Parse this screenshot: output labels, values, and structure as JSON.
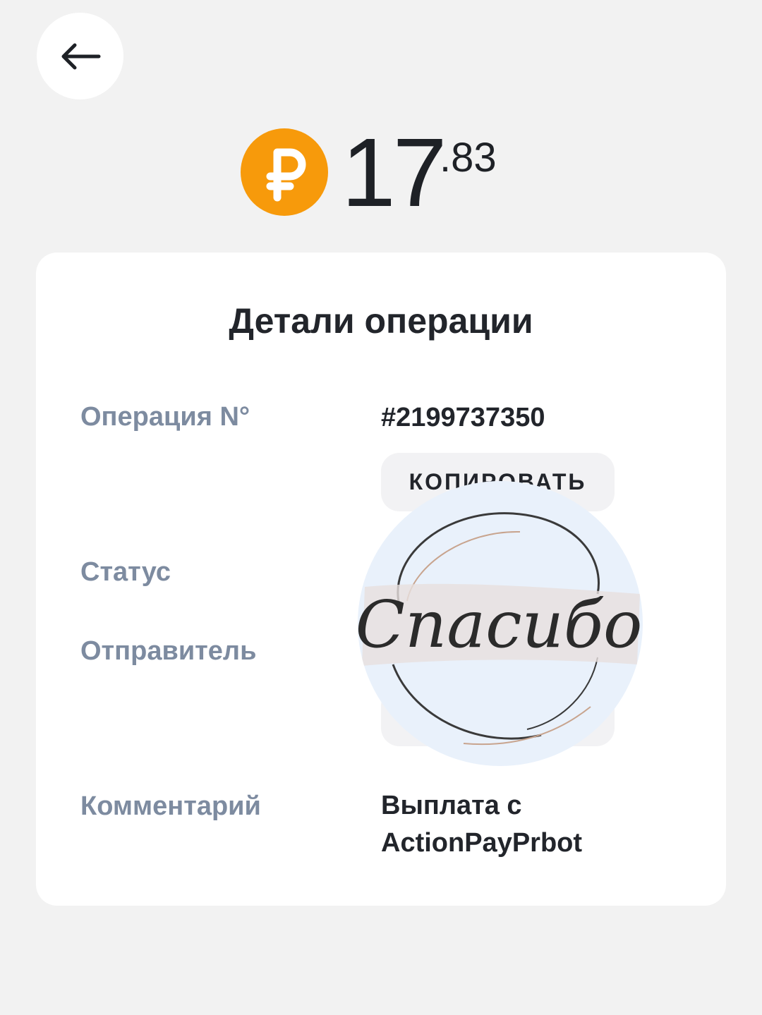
{
  "header": {
    "back_icon": "arrow-left-icon"
  },
  "amount": {
    "currency_icon": "ruble-coin-icon",
    "integer": "17",
    "fraction": ".83",
    "coin_color": "#f79a0b"
  },
  "details": {
    "title": "Детали операции",
    "operation_label": "Операция N°",
    "operation_number": "#2199737350",
    "copy_label": "КОПИРОВАТЬ",
    "status_label": "Статус",
    "sender_label": "Отправитель",
    "comment_label": "Комментарий",
    "comment_line1": "Выплата с",
    "comment_line2": "ActionPayPrbot"
  },
  "sticker": {
    "text": "Спасибо"
  },
  "colors": {
    "background": "#f2f2f2",
    "label": "#7d8ba0",
    "text": "#22252b"
  }
}
